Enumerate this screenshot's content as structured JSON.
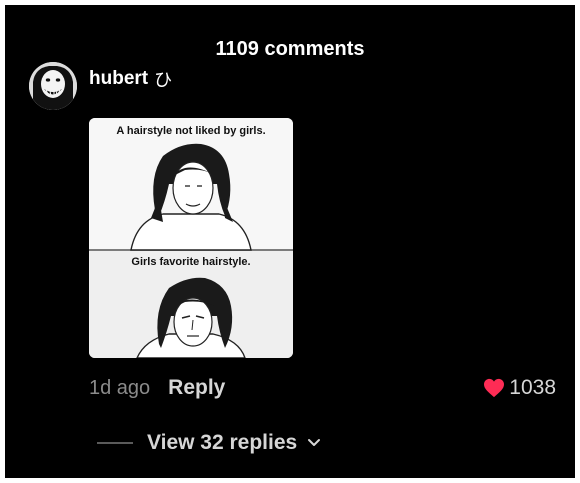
{
  "header": {
    "comment_count_label": "1109 comments"
  },
  "comment": {
    "username": "hubert",
    "username_suffix": "ひ",
    "time": "1d ago",
    "reply_label": "Reply",
    "likes": "1038",
    "view_replies_label": "View 32 replies",
    "image_caption_top": "A hairstyle not liked by girls.",
    "image_caption_bottom": "Girls favorite hairstyle."
  },
  "colors": {
    "background": "#000000",
    "heart": "#fe2c55",
    "text_primary": "#ffffff",
    "text_muted": "#8b8b8b"
  },
  "icons": {
    "like": "heart-icon",
    "expand": "chevron-down-icon"
  }
}
